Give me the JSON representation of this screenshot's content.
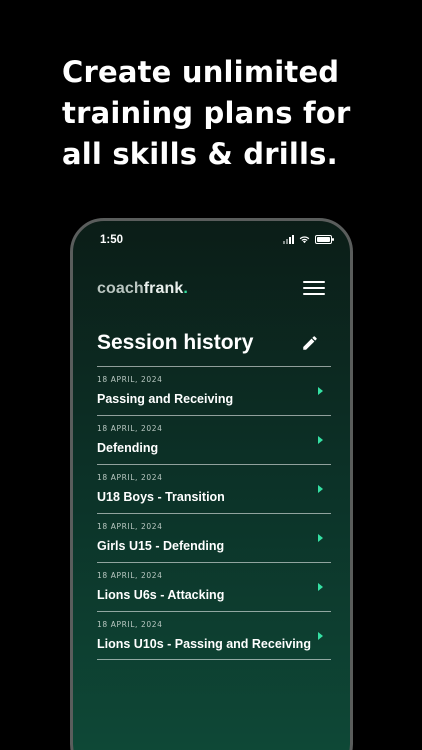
{
  "headline": {
    "lines": [
      "Create unlimited",
      "training plans for",
      "all skills & drills."
    ]
  },
  "status_bar": {
    "time": "1:50"
  },
  "app": {
    "logo_coach": "coach",
    "logo_frank": "frank",
    "logo_dot": ".",
    "logo_dot_color": "#34e0a1",
    "menu_icon": "hamburger-menu-icon"
  },
  "page": {
    "title": "Session history",
    "edit_icon": "pencil-icon"
  },
  "sessions": [
    {
      "date": "18 APRIL, 2024",
      "name": "Passing and Receiving"
    },
    {
      "date": "18 APRIL, 2024",
      "name": "Defending"
    },
    {
      "date": "18 APRIL, 2024",
      "name": "U18 Boys - Transition"
    },
    {
      "date": "18 APRIL, 2024",
      "name": "Girls U15 - Defending"
    },
    {
      "date": "18 APRIL, 2024",
      "name": "Lions U6s - Attacking"
    },
    {
      "date": "18 APRIL, 2024",
      "name": "Lions U10s - Passing and Receiving"
    }
  ],
  "colors": {
    "accent": "#34e0a1",
    "background": "#000000",
    "phone_gradient_top": "#0b1d17",
    "phone_gradient_bottom": "#0e4a38"
  }
}
